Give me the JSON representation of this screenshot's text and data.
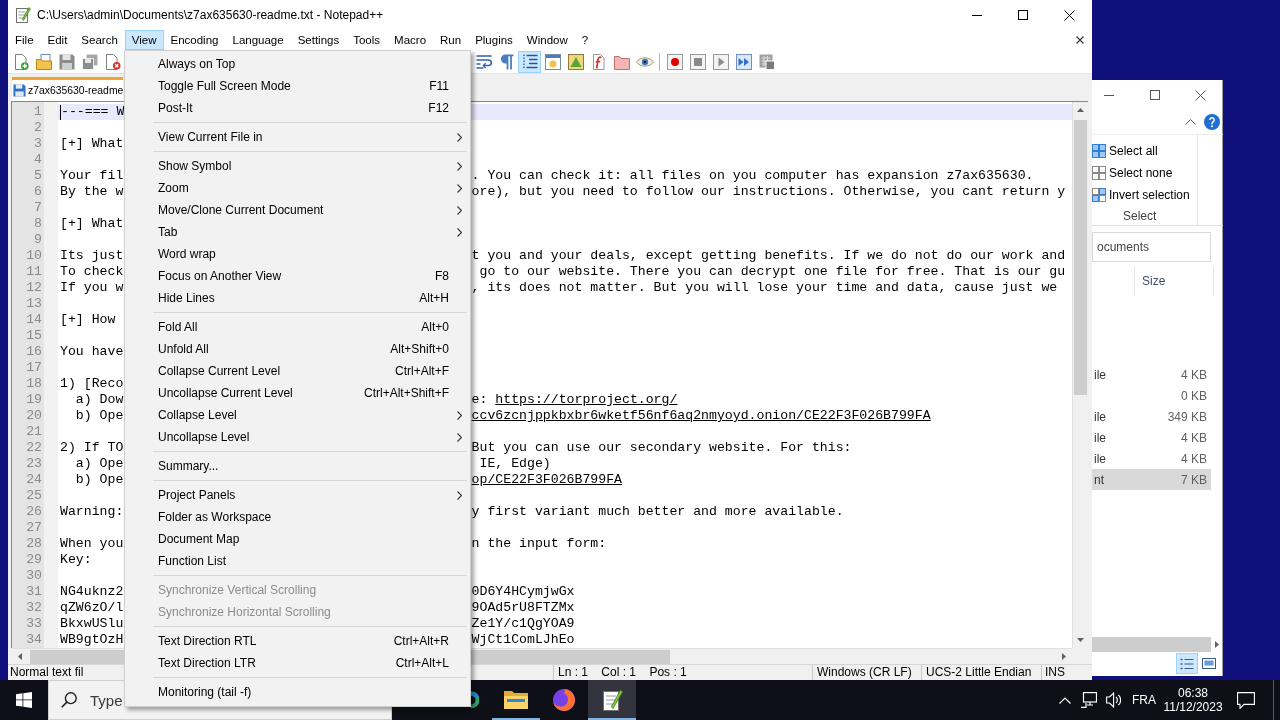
{
  "window": {
    "title": "C:\\Users\\admin\\Documents\\z7ax635630-readme.txt - Notepad++"
  },
  "menu_bar": [
    {
      "label": "File",
      "selected": false
    },
    {
      "label": "Edit",
      "selected": false
    },
    {
      "label": "Search",
      "selected": false
    },
    {
      "label": "View",
      "selected": true
    },
    {
      "label": "Encoding",
      "selected": false
    },
    {
      "label": "Language",
      "selected": false
    },
    {
      "label": "Settings",
      "selected": false
    },
    {
      "label": "Tools",
      "selected": false
    },
    {
      "label": "Macro",
      "selected": false
    },
    {
      "label": "Run",
      "selected": false
    },
    {
      "label": "Plugins",
      "selected": false
    },
    {
      "label": "Window",
      "selected": false
    },
    {
      "label": "?",
      "selected": false
    }
  ],
  "toolbar": {
    "left": [
      {
        "kind": "new",
        "pressed": false
      },
      {
        "kind": "open",
        "pressed": false
      },
      {
        "kind": "save",
        "pressed": false
      },
      {
        "kind": "save_all",
        "pressed": false
      },
      {
        "kind": "close",
        "pressed": false
      }
    ],
    "right": [
      {
        "kind": "word_wrap",
        "pressed": false
      },
      {
        "kind": "all_chars",
        "pressed": false
      },
      {
        "kind": "indent_guide",
        "pressed": true
      },
      {
        "kind": "language",
        "pressed": false
      },
      {
        "kind": "doc_map",
        "pressed": false
      },
      {
        "kind": "function_list",
        "pressed": false
      },
      {
        "kind": "workspace",
        "pressed": false
      },
      {
        "kind": "monitor",
        "pressed": false
      },
      {
        "kind": "separator"
      },
      {
        "kind": "record",
        "pressed": false
      },
      {
        "kind": "stop",
        "pressed": false
      },
      {
        "kind": "play",
        "pressed": false
      },
      {
        "kind": "play_multi",
        "pressed": false
      },
      {
        "kind": "save_macro",
        "pressed": false
      }
    ]
  },
  "tabs": [
    {
      "label": "z7ax635630-readme",
      "selected": true,
      "modified": false
    }
  ],
  "editor": {
    "lines": [
      {
        "number": "1",
        "left": "---=== W",
        "current": true
      },
      {
        "number": "2",
        "current": false
      },
      {
        "number": "3",
        "left": "[+] What",
        "current": false
      },
      {
        "number": "4",
        "current": false
      },
      {
        "number": "5",
        "left": "Your fil",
        "right": ". You can check it: all files on you computer has expansion z7ax635630.",
        "current": false
      },
      {
        "number": "6",
        "left": "By the w",
        "right": "ore), but you need to follow our instructions. Otherwise, you cant return y",
        "current": false
      },
      {
        "number": "7",
        "current": false
      },
      {
        "number": "8",
        "left": "[+] What",
        "current": false
      },
      {
        "number": "9",
        "current": false
      },
      {
        "number": "10",
        "left": "Its just",
        "right": "t you and your deals, except getting benefits. If we do not do our work and",
        "current": false
      },
      {
        "number": "11",
        "left": "To check",
        "right": " go to our website. There you can decrypt one file for free. That is our gu",
        "current": false
      },
      {
        "number": "12",
        "left": "If you w",
        "right": ", its does not matter. But you will lose your time and data, cause just we",
        "current": false
      },
      {
        "number": "13",
        "current": false
      },
      {
        "number": "14",
        "left": "[+] How",
        "current": false
      },
      {
        "number": "15",
        "current": false
      },
      {
        "number": "16",
        "left": "You have",
        "current": false
      },
      {
        "number": "17",
        "current": false
      },
      {
        "number": "18",
        "left": "1) [Reco",
        "current": false
      },
      {
        "number": "19",
        "left": "  a) Dow",
        "right": "e: ",
        "link": "https://torproject.org/",
        "current": false
      },
      {
        "number": "20",
        "left": "  b) Ope",
        "link": "ccv6zcnjppkbxbr6wketf56nf6aq2nmyoyd.onion/CE22F3F026B799FA",
        "current": false
      },
      {
        "number": "21",
        "current": false
      },
      {
        "number": "22",
        "left": "2) If TO",
        "right": "But you can use our secondary website. For this:",
        "current": false
      },
      {
        "number": "23",
        "left": "  a) Ope",
        "right": " IE, Edge)",
        "current": false
      },
      {
        "number": "24",
        "left": "  b) Ope",
        "link": "op/CE22F3F026B799FA",
        "current": false
      },
      {
        "number": "25",
        "current": false
      },
      {
        "number": "26",
        "left": "Warning:",
        "right": "y first variant much better and more available.",
        "current": false
      },
      {
        "number": "27",
        "current": false
      },
      {
        "number": "28",
        "left": "When you",
        "right": "n the input form:",
        "current": false
      },
      {
        "number": "29",
        "left": "Key:",
        "current": false
      },
      {
        "number": "30",
        "current": false
      },
      {
        "number": "31",
        "left": "NG4uknz2",
        "right": "0D6Y4HCymjwGx",
        "current": false
      },
      {
        "number": "32",
        "left": "qZW6zO/l",
        "right": "9OAd5rU8FTZMx",
        "current": false
      },
      {
        "number": "33",
        "left": "BkxwUSlu",
        "right": "Ze1Y/c1QgYOA9",
        "current": false
      },
      {
        "number": "34",
        "left": "WB9gtOzH",
        "right": "WjCt1ComLJhEo",
        "current": false
      }
    ]
  },
  "status_bar": [
    "Normal text fil",
    "Ln : 1    Col : 1    Pos : 1",
    "Windows (CR LF)",
    "UCS-2 Little Endian",
    "INS"
  ],
  "view_menu": {
    "items": [
      {
        "kind": "item",
        "label": "Always on Top",
        "submenu": false,
        "disabled": false
      },
      {
        "kind": "item",
        "label": "Toggle Full Screen Mode",
        "shortcut": "F11",
        "submenu": false,
        "disabled": false
      },
      {
        "kind": "item",
        "label": "Post-It",
        "shortcut": "F12",
        "submenu": false,
        "disabled": false
      },
      {
        "kind": "separator"
      },
      {
        "kind": "item",
        "label": "View Current File in",
        "submenu": true,
        "disabled": false
      },
      {
        "kind": "separator"
      },
      {
        "kind": "item",
        "label": "Show Symbol",
        "submenu": true,
        "disabled": false
      },
      {
        "kind": "item",
        "label": "Zoom",
        "submenu": true,
        "disabled": false
      },
      {
        "kind": "item",
        "label": "Move/Clone Current Document",
        "submenu": true,
        "disabled": false
      },
      {
        "kind": "item",
        "label": "Tab",
        "submenu": true,
        "disabled": false
      },
      {
        "kind": "item",
        "label": "Word wrap",
        "submenu": false,
        "disabled": false
      },
      {
        "kind": "item",
        "label": "Focus on Another View",
        "shortcut": "F8",
        "submenu": false,
        "disabled": false
      },
      {
        "kind": "item",
        "label": "Hide Lines",
        "shortcut": "Alt+H",
        "submenu": false,
        "disabled": false
      },
      {
        "kind": "separator"
      },
      {
        "kind": "item",
        "label": "Fold All",
        "shortcut": "Alt+0",
        "submenu": false,
        "disabled": false
      },
      {
        "kind": "item",
        "label": "Unfold All",
        "shortcut": "Alt+Shift+0",
        "submenu": false,
        "disabled": false
      },
      {
        "kind": "item",
        "label": "Collapse Current Level",
        "shortcut": "Ctrl+Alt+F",
        "submenu": false,
        "disabled": false
      },
      {
        "kind": "item",
        "label": "Uncollapse Current Level",
        "shortcut": "Ctrl+Alt+Shift+F",
        "submenu": false,
        "disabled": false
      },
      {
        "kind": "item",
        "label": "Collapse Level",
        "submenu": true,
        "disabled": false
      },
      {
        "kind": "item",
        "label": "Uncollapse Level",
        "submenu": true,
        "disabled": false
      },
      {
        "kind": "separator"
      },
      {
        "kind": "item",
        "label": "Summary...",
        "submenu": false,
        "disabled": false
      },
      {
        "kind": "separator"
      },
      {
        "kind": "item",
        "label": "Project Panels",
        "submenu": true,
        "disabled": false
      },
      {
        "kind": "item",
        "label": "Folder as Workspace",
        "submenu": false,
        "disabled": false
      },
      {
        "kind": "item",
        "label": "Document Map",
        "submenu": false,
        "disabled": false
      },
      {
        "kind": "item",
        "label": "Function List",
        "submenu": false,
        "disabled": false
      },
      {
        "kind": "separator"
      },
      {
        "kind": "item",
        "label": "Synchronize Vertical Scrolling",
        "submenu": false,
        "disabled": true
      },
      {
        "kind": "item",
        "label": "Synchronize Horizontal Scrolling",
        "submenu": false,
        "disabled": true
      },
      {
        "kind": "separator"
      },
      {
        "kind": "item",
        "label": "Text Direction RTL",
        "shortcut": "Ctrl+Alt+R",
        "submenu": false,
        "disabled": false
      },
      {
        "kind": "item",
        "label": "Text Direction LTR",
        "shortcut": "Ctrl+Alt+L",
        "submenu": false,
        "disabled": false
      },
      {
        "kind": "separator"
      },
      {
        "kind": "item",
        "label": "Monitoring (tail -f)",
        "submenu": false,
        "disabled": false
      }
    ]
  },
  "explorer": {
    "ribbon": {
      "items": [
        {
          "kind": "all",
          "label": "Select all"
        },
        {
          "kind": "none",
          "label": "Select none"
        },
        {
          "kind": "invert",
          "label": "Invert selection"
        }
      ],
      "group_label": "Select"
    },
    "address": "ocuments",
    "columns": [
      "Size"
    ],
    "rows": [
      {
        "column_1": "ile",
        "size": "4 KB",
        "selected": false
      },
      {
        "size": "0 KB",
        "selected": false
      },
      {
        "column_1": "ile",
        "size": "349 KB",
        "selected": false
      },
      {
        "column_1": "ile",
        "size": "4 KB",
        "selected": false
      },
      {
        "column_1": "ile",
        "size": "4 KB",
        "selected": false
      },
      {
        "column_1": "nt",
        "size": "7 KB",
        "selected": true
      }
    ],
    "views": [
      {
        "kind": "details",
        "selected": true
      },
      {
        "kind": "large_icons",
        "selected": false
      }
    ]
  },
  "taskbar": {
    "search": {
      "placeholder": "Type"
    },
    "apps": [
      {
        "kind": "browser_partial",
        "active": false,
        "running": false
      },
      {
        "kind": "folder",
        "active": false,
        "running": true
      },
      {
        "kind": "browser",
        "active": false,
        "running": false
      },
      {
        "kind": "notepad",
        "active": true,
        "running": true
      }
    ],
    "tray": {
      "language": "FRA",
      "time": "06:38",
      "date": "11/12/2023"
    }
  }
}
